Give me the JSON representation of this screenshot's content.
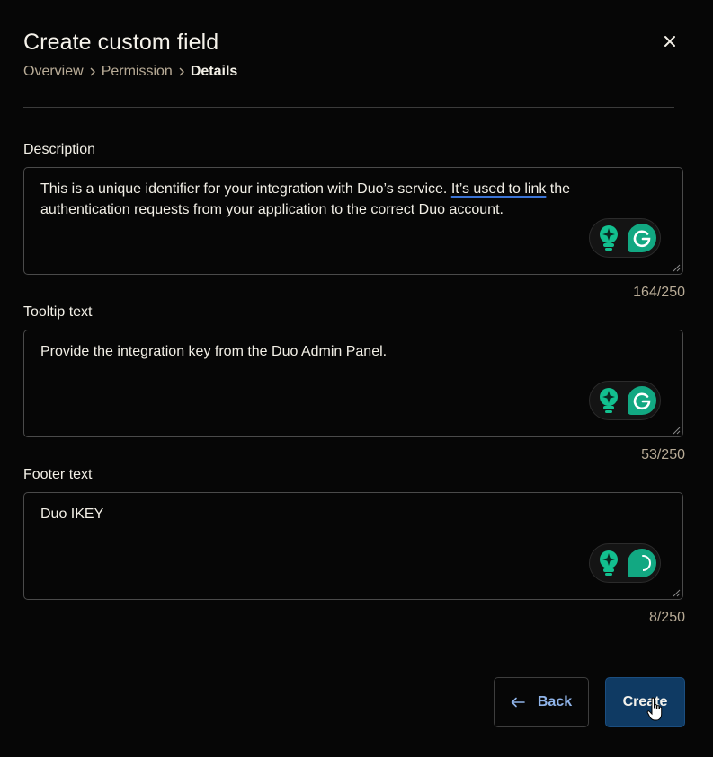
{
  "dialog": {
    "title": "Create custom field",
    "breadcrumb": [
      {
        "label": "Overview"
      },
      {
        "label": "Permission"
      },
      {
        "label": "Details"
      }
    ]
  },
  "fields": {
    "description": {
      "label": "Description",
      "value_part1": "This is a unique identifier for your integration with Duo’s service. ",
      "value_underlined": "It’s used to link",
      "value_part2": " the authentication requests from your application to the correct Duo account.",
      "counter": "164/250"
    },
    "tooltip": {
      "label": "Tooltip text",
      "value": "Provide the integration key from the Duo Admin Panel.",
      "counter": "53/250"
    },
    "footer": {
      "label": "Footer text",
      "value": "Duo IKEY",
      "counter": "8/250"
    }
  },
  "actions": {
    "back_label": "Back",
    "create_label": "Create"
  },
  "icons": {
    "close": "close-icon",
    "breadcrumb_separator": "chevron-right-icon",
    "assistant_bulb": "lightbulb-sparkle-icon",
    "grammarly": "grammarly-icon",
    "back_arrow": "arrow-left-icon",
    "cursor": "hand-pointer-icon"
  },
  "colors": {
    "background": "#060606",
    "muted_text": "#b8ab96",
    "primary_button": "#0f3a63",
    "link_text": "#8fb3e8",
    "grammarly_green": "#12a882"
  }
}
